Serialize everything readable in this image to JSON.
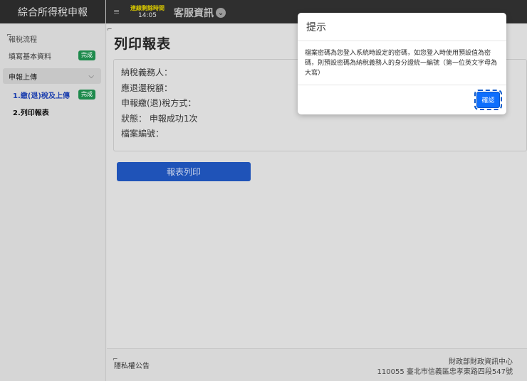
{
  "sidebar": {
    "title": "綜合所得稅申報",
    "section_label": "報稅流程",
    "items": [
      {
        "label": "填寫基本資料",
        "badge": "完成"
      }
    ],
    "group": {
      "label": "申報上傳"
    },
    "sub_items": [
      {
        "label": "1.繳(退)稅及上傳",
        "badge": "完成"
      },
      {
        "label": "2.列印報表"
      }
    ]
  },
  "topbar": {
    "online_label": "連線剩餘時間",
    "online_time": "14:05",
    "service_label": "客服資訊"
  },
  "main": {
    "title": "列印報表",
    "info": [
      "納稅義務人：",
      "應退還稅額：",
      "申報繳(退)稅方式：",
      "狀態： 申報成功1次",
      "檔案編號："
    ],
    "print_button": "報表列印"
  },
  "footer": {
    "privacy": "隱私權公告",
    "org": "財政部財政資訊中心",
    "address": "110055 臺北市信義區忠孝東路四段547號"
  },
  "modal": {
    "title": "提示",
    "body": "檔案密碼為您登入系統時設定的密碼，如您登入時使用預設值為密碼，則預設密碼為納稅義務人的身分證統一編號（第一位英文字母為大寫）",
    "confirm": "確認"
  },
  "colors": {
    "accent": "#0d6efd",
    "print_button": "#1f53b8",
    "badge": "#1e8a4c",
    "topbar": "#2f2f2f"
  }
}
